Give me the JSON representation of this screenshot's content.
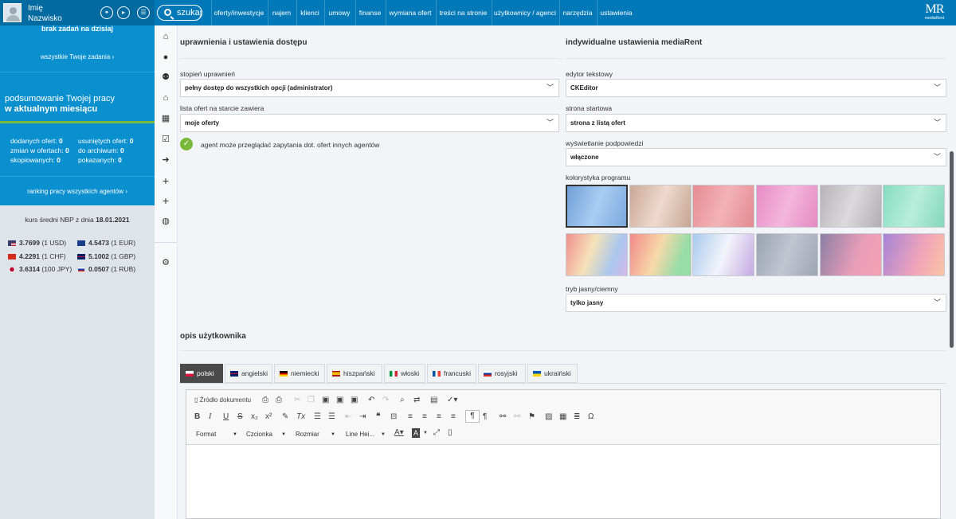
{
  "user": {
    "first_name": "Imię",
    "last_name": "Nazwisko"
  },
  "search": {
    "label": "szukaj"
  },
  "nav": [
    "oferty/inwestycje",
    "najem",
    "klienci",
    "umowy",
    "finanse",
    "wymiana ofert",
    "treści na stronie",
    "użytkownicy / agenci",
    "narzędzia",
    "ustawienia"
  ],
  "logo": {
    "mark": "MR",
    "name": "mediaRent"
  },
  "sidebar": {
    "tasks_text": "brak zadań na dzisiaj",
    "tasks_link": "wszystkie Twoje zadania",
    "summary_line1": "podsumowanie Twojej pracy",
    "summary_line2": "w aktualnym miesiącu",
    "stats_left": [
      {
        "label": "dodanych ofert:",
        "value": "0"
      },
      {
        "label": "zmian w ofertach:",
        "value": "0"
      },
      {
        "label": "skopiowanych:",
        "value": "0"
      }
    ],
    "stats_right": [
      {
        "label": "usuniętych ofert:",
        "value": "0"
      },
      {
        "label": "do archiwum:",
        "value": "0"
      },
      {
        "label": "pokazanych:",
        "value": "0"
      }
    ],
    "ranking_link": "ranking pracy wszystkich agentów",
    "nbp_label": "kurs średni NBP z dnia",
    "nbp_date": "18.01.2021",
    "rates_left": [
      {
        "value": "3.7699",
        "unit": "(1 USD)"
      },
      {
        "value": "4.2291",
        "unit": "(1 CHF)"
      },
      {
        "value": "3.6314",
        "unit": "(100 JPY)"
      }
    ],
    "rates_right": [
      {
        "value": "4.5473",
        "unit": "(1 EUR)"
      },
      {
        "value": "5.1002",
        "unit": "(1 GBP)"
      },
      {
        "value": "0.0507",
        "unit": "(1 RUB)"
      }
    ]
  },
  "icons": [
    "home-icon",
    "user-icon",
    "add-user-icon",
    "house-icon",
    "calendar-icon",
    "tasks-icon",
    "logout-icon",
    "plus-icon",
    "plus-icon",
    "globe-icon",
    "settings-icon"
  ],
  "left_section": {
    "title": "uprawnienia i ustawienia dostępu",
    "permission_label": "stopień uprawnień",
    "permission_value": "pełny dostęp do wszystkich opcji (administrator)",
    "list_label": "lista ofert na starcie zawiera",
    "list_value": "moje oferty",
    "checkbox_label": "agent może przeglądać zapytania dot. ofert innych agentów"
  },
  "right_section": {
    "title": "indywidualne ustawienia mediaRent",
    "editor_label": "edytor tekstowy",
    "editor_value": "CKEditor",
    "start_label": "strona startowa",
    "start_value": "strona z listą ofert",
    "hints_label": "wyświetlanie podpowiedzi",
    "hints_value": "włączone",
    "colors_label": "kolorystyka programu",
    "mode_label": "tryb jasny/ciemny",
    "mode_value": "tylko jasny"
  },
  "description": {
    "title": "opis użytkownika"
  },
  "languages": [
    "polski",
    "angielski",
    "niemiecki",
    "hiszpański",
    "włoski",
    "francuski",
    "rosyjski",
    "ukraiński"
  ],
  "editor_toolbar": {
    "source": "Źródło dokumentu",
    "format": "Format",
    "font": "Czcionka",
    "size": "Rozmiar",
    "line_height": "Line Hei..."
  },
  "colors": {
    "accent": "#0179b8",
    "sidebar_blue": "#0a8fcf",
    "check": "#7ab83b"
  }
}
